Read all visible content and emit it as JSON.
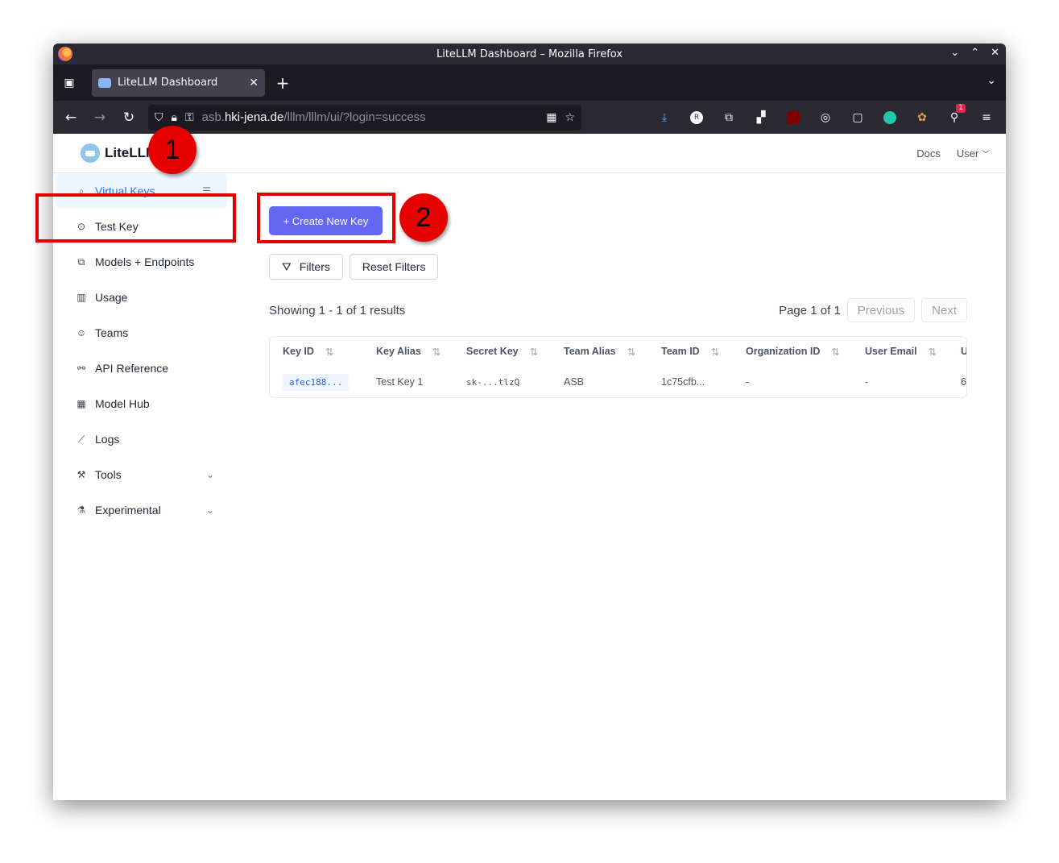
{
  "window": {
    "title": "LiteLLM Dashboard – Mozilla Firefox"
  },
  "tab": {
    "title": "LiteLLM Dashboard"
  },
  "urlbar": {
    "host_prefix": "asb.",
    "host": "hki-jena.de",
    "path": "/lllm/lllm/ui/?login=success"
  },
  "toolbar": {
    "badge_count": "1"
  },
  "app": {
    "brand": "LiteLLM",
    "docs_label": "Docs",
    "user_label": "User"
  },
  "sidebar": {
    "items": [
      {
        "label": "Virtual Keys",
        "icon": "key-search-icon"
      },
      {
        "label": "Test Key",
        "icon": "play-circle-icon"
      },
      {
        "label": "Models + Endpoints",
        "icon": "block-icon"
      },
      {
        "label": "Usage",
        "icon": "bar-chart-icon"
      },
      {
        "label": "Teams",
        "icon": "team-icon"
      },
      {
        "label": "API Reference",
        "icon": "api-icon"
      },
      {
        "label": "Model Hub",
        "icon": "grid-icon"
      },
      {
        "label": "Logs",
        "icon": "line-chart-icon"
      },
      {
        "label": "Tools",
        "icon": "tool-icon"
      },
      {
        "label": "Experimental",
        "icon": "flask-icon"
      }
    ]
  },
  "main": {
    "create_button": "+ Create New Key",
    "filters_button": "Filters",
    "reset_filters_button": "Reset Filters",
    "results_text": "Showing 1 - 1 of 1 results",
    "page_text": "Page 1 of 1",
    "previous_label": "Previous",
    "next_label": "Next"
  },
  "table": {
    "columns": [
      "Key ID",
      "Key Alias",
      "Secret Key",
      "Team Alias",
      "Team ID",
      "Organization ID",
      "User Email",
      "U"
    ],
    "row": [
      "afec188...",
      "Test Key 1",
      "sk-...tlzQ",
      "ASB",
      "1c75cfb...",
      "-",
      "-",
      "6"
    ]
  },
  "annotations": {
    "one": "1",
    "two": "2"
  },
  "colors": {
    "accent": "#6366f1",
    "active_bg": "#eef6ff",
    "active_text": "#1d72ff",
    "annotation": "#e00000"
  }
}
